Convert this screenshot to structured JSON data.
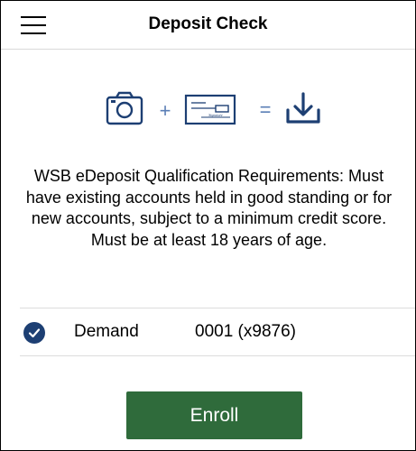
{
  "header": {
    "title": "Deposit Check",
    "menu_icon": "hamburger-menu-icon"
  },
  "illustration": {
    "icons": [
      "camera-icon",
      "plus-icon",
      "check-icon",
      "equals-icon",
      "download-icon"
    ],
    "plus": "+",
    "equals": "=",
    "check_signature": "Signature",
    "icon_color": "#1d3f73",
    "operator_color": "#5b7fb6"
  },
  "description": {
    "text": "WSB eDeposit Qualification Requirements: Must have existing accounts held in good standing or for new accounts, subject to a minimum credit score. Must be at least 18 years of age."
  },
  "account": {
    "selected": true,
    "type": "Demand",
    "number": "0001 (x9876)",
    "check_color": "#1d3f73"
  },
  "actions": {
    "enroll_label": "Enroll",
    "enroll_color": "#2f6b3b"
  }
}
